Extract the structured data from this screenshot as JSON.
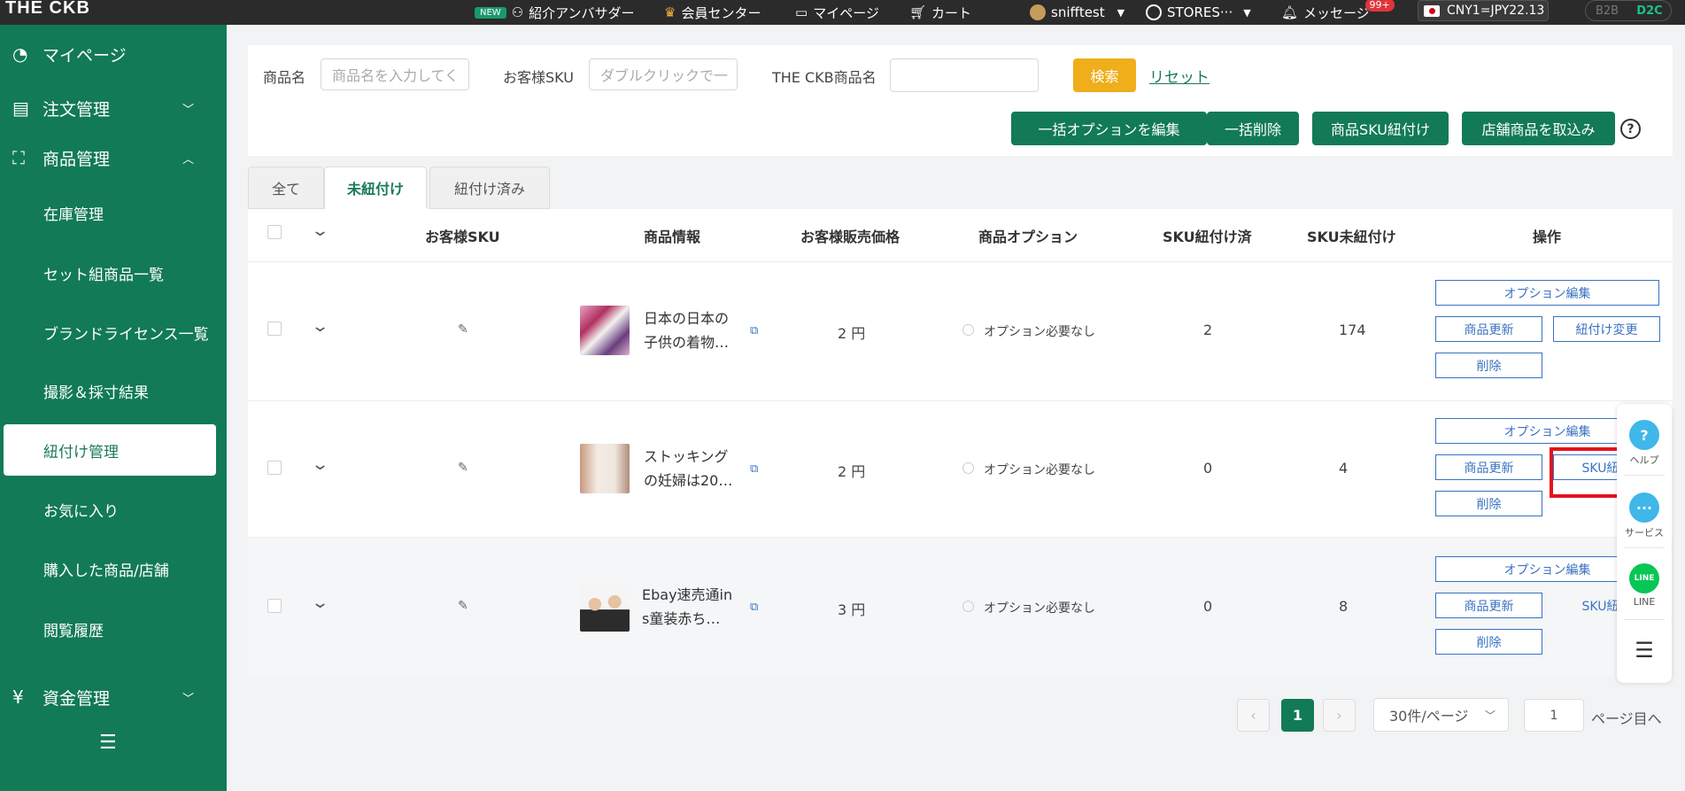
{
  "topbar": {
    "logo": "THE CKB",
    "new_badge": "NEW",
    "ambassador": "紹介アンバサダー",
    "member_center": "会員センター",
    "mypage": "マイページ",
    "cart": "カート",
    "user": "snifftest",
    "store": "STORES···",
    "messages": "メッセージ",
    "messages_badge": "99+",
    "rate": "CNY1=JPY22.13",
    "b2b": "B2B",
    "d2c": "D2C"
  },
  "sidebar": {
    "mypage": "マイページ",
    "orders": "注文管理",
    "products": "商品管理",
    "sub": [
      "在庫管理",
      "セット組商品一覧",
      "ブランドライセンス一覧",
      "撮影＆採寸結果",
      "紐付け管理",
      "お気に入り",
      "購入した商品/店舗",
      "閲覧履歴"
    ],
    "funds": "資金管理"
  },
  "search": {
    "product_name_label": "商品名",
    "product_name_placeholder": "商品名を入力してく",
    "customer_sku_label": "お客様SKU",
    "customer_sku_placeholder": "ダブルクリックで一",
    "ckb_name_label": "THE CKB商品名",
    "ckb_name_value": "",
    "search_btn": "検索",
    "reset_link": "リセット"
  },
  "actions": {
    "bulk_option_edit": "一括オプションを編集",
    "bulk_delete": "一括削除",
    "sku_link": "商品SKU紐付け",
    "import_store": "店舗商品を取込み"
  },
  "tabs": [
    "全て",
    "未紐付け",
    "紐付け済み"
  ],
  "table": {
    "headers": [
      "お客様SKU",
      "商品情報",
      "お客様販売価格",
      "商品オプション",
      "SKU紐付け済",
      "SKU未紐付け",
      "操作"
    ],
    "rows": [
      {
        "name1": "日本の日本の",
        "name2": "子供の着物…",
        "price": "2 円",
        "option": "オプション必要なし",
        "linked": "2",
        "unlinked": "174",
        "btn_option": "オプション編集",
        "btn_update": "商品更新",
        "btn_change": "紐付け変更",
        "btn_delete": "削除"
      },
      {
        "name1": "ストッキング",
        "name2": "の妊婦は20…",
        "price": "2 円",
        "option": "オプション必要なし",
        "linked": "0",
        "unlinked": "4",
        "btn_option": "オプション編集",
        "btn_update": "商品更新",
        "btn_change": "SKU紐付",
        "btn_delete": "削除"
      },
      {
        "name1": "Ebay速売通in",
        "name2": "s童装赤ち…",
        "price": "3 円",
        "option": "オプション必要なし",
        "linked": "0",
        "unlinked": "8",
        "btn_option": "オプション編集",
        "btn_update": "商品更新",
        "btn_change": "SKU紐付",
        "btn_delete": "削除"
      }
    ]
  },
  "pagination": {
    "prev": "‹",
    "current": "1",
    "next": "›",
    "page_size": "30件/ページ",
    "goto_value": "1",
    "goto_suffix": "ページ目へ"
  },
  "float_panel": {
    "help": "ヘルプ",
    "service": "サービス",
    "line": "LINE",
    "line_logo": "LINE"
  }
}
